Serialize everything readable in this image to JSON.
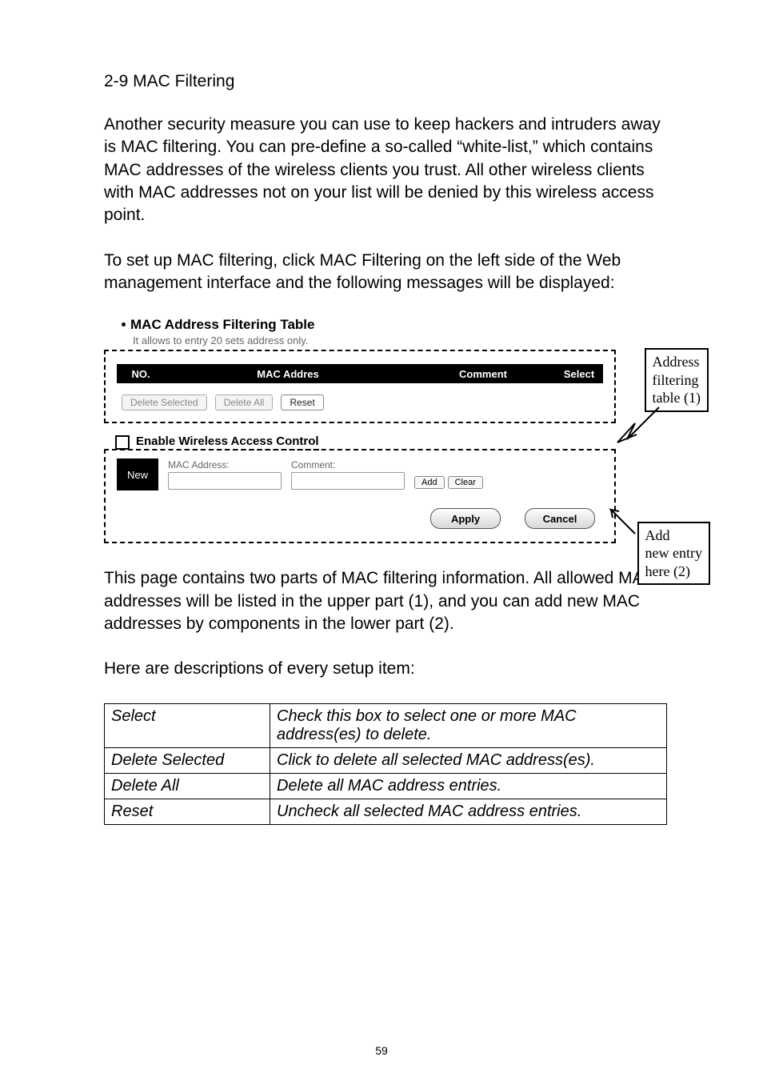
{
  "section_heading": "2-9 MAC Filtering",
  "para1": "Another security measure you can use to keep hackers and intruders away is MAC filtering. You can pre-define a so-called “white-list,” which contains MAC addresses of the wireless clients you trust. All other wireless clients with MAC addresses not on your list will be denied by this wireless access point.",
  "para2": "To set up MAC filtering, click MAC Filtering on the left side of the Web management interface and the following messages will be displayed:",
  "figure": {
    "panel_title": "MAC Address Filtering Table",
    "panel_subtitle": "It allows to entry 20 sets address only.",
    "table_headers": {
      "no": "NO.",
      "mac": "MAC Addres",
      "comment": "Comment",
      "select": "Select"
    },
    "btn_delete_selected": "Delete Selected",
    "btn_delete_all": "Delete All",
    "btn_reset": "Reset",
    "enable_label": "Enable Wireless Access Control",
    "new_label": "New",
    "mac_label": "MAC Address:",
    "comment_label": "Comment:",
    "btn_add": "Add",
    "btn_clear": "Clear",
    "btn_apply": "Apply",
    "btn_cancel": "Cancel",
    "callout1_line1": "Address",
    "callout1_line2": "filtering",
    "callout1_line3": "table (1)",
    "callout2_line1": "Add",
    "callout2_line2": "new entry",
    "callout2_line3": "here (2)"
  },
  "para3": "This page contains two parts of MAC filtering information. All allowed MAC addresses will be listed in the upper part (1), and you can add new MAC addresses by components in the lower part (2).",
  "para4": "Here are descriptions of every setup item:",
  "desc_table": [
    {
      "name": "Select",
      "desc": "Check this box to select one or more MAC address(es) to delete."
    },
    {
      "name": "Delete Selected",
      "desc": "Click to delete all selected MAC address(es)."
    },
    {
      "name": "Delete All",
      "desc": "Delete all MAC address entries."
    },
    {
      "name": "Reset",
      "desc": "Uncheck all selected MAC address entries."
    }
  ],
  "page_number": "59"
}
